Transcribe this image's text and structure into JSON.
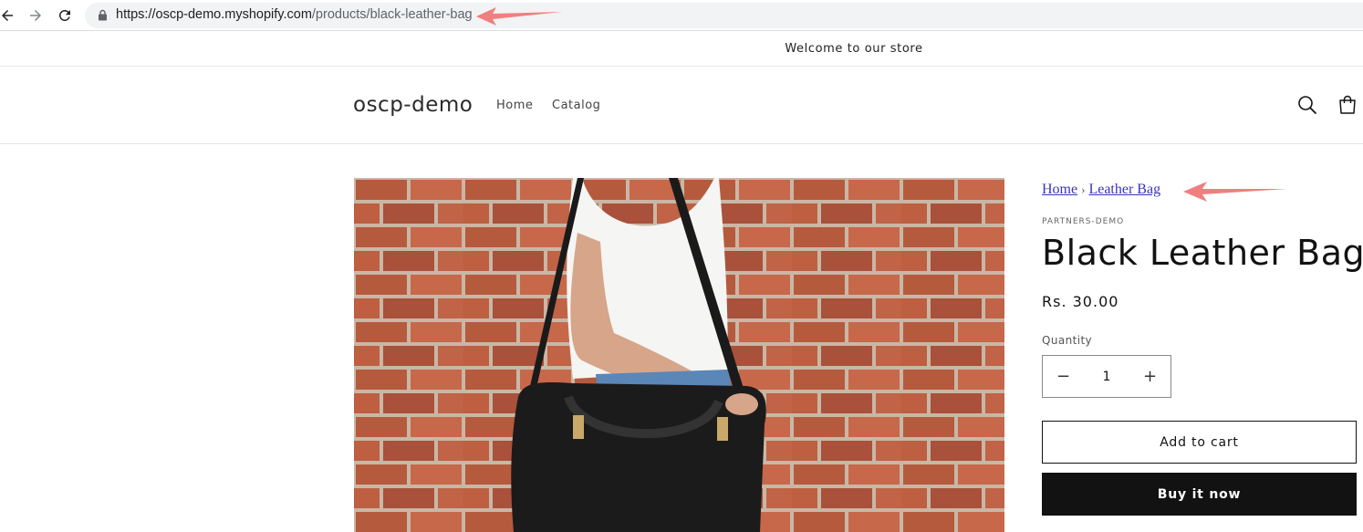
{
  "browser": {
    "url_host": "https://oscp-demo.myshopify.com",
    "url_path": "/products/black-leather-bag",
    "back_icon": "arrow-left-icon",
    "forward_icon": "arrow-right-icon",
    "reload_icon": "reload-icon",
    "lock_icon": "lock-icon"
  },
  "announcement": {
    "text": "Welcome to our store"
  },
  "header": {
    "logo": "oscp-demo",
    "menu": [
      {
        "label": "Home"
      },
      {
        "label": "Catalog"
      }
    ],
    "search_icon": "search-icon",
    "cart_icon": "cart-icon"
  },
  "product": {
    "breadcrumb": [
      {
        "label": "Home"
      },
      {
        "label": "Leather Bag"
      }
    ],
    "breadcrumb_separator": "›",
    "vendor": "PARTNERS-DEMO",
    "title": "Black Leather Bag",
    "price": "Rs. 30.00",
    "quantity_label": "Quantity",
    "quantity_value": "1",
    "decrease_label": "−",
    "increase_label": "+",
    "add_to_cart_label": "Add to cart",
    "buy_now_label": "Buy it now"
  },
  "colors": {
    "annotation_arrow": "#f07f7f",
    "buy_button_bg": "#121212",
    "breadcrumb_link": "#3a35b8"
  }
}
